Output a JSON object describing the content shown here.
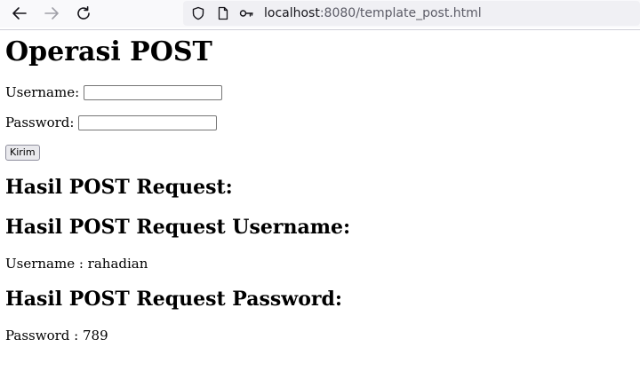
{
  "browser": {
    "url_host": "localhost",
    "url_rest": ":8080/template_post.html"
  },
  "page": {
    "title": "Operasi POST",
    "form": {
      "username_label": "Username:",
      "username_value": "",
      "password_label": "Password:",
      "password_value": "",
      "submit_label": "Kirim"
    },
    "results": {
      "heading_main": "Hasil POST Request:",
      "heading_username": "Hasil POST Request Username:",
      "username_text": "Username : rahadian",
      "heading_password": "Hasil POST Request Password:",
      "password_text": "Password : 789"
    }
  },
  "icons": {
    "back": "arrow-left-icon",
    "forward": "arrow-right-icon",
    "reload": "reload-icon",
    "tracking": "shield-icon",
    "page": "page-icon",
    "permissions": "key-icon"
  }
}
